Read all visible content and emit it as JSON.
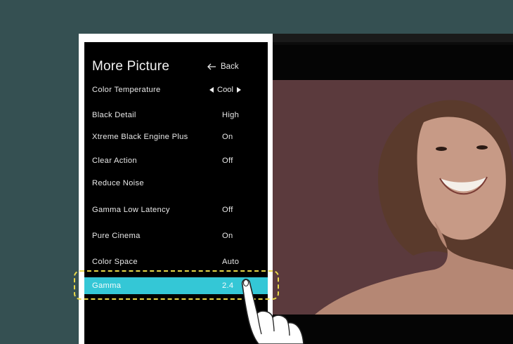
{
  "menu": {
    "title": "More Picture",
    "back_label": "Back",
    "color_temperature": {
      "label": "Color Temperature",
      "value": "Cool"
    },
    "items": [
      {
        "label": "Black Detail",
        "value": "High"
      },
      {
        "label": "Xtreme Black Engine Plus",
        "value": "On"
      },
      {
        "label": "Clear Action",
        "value": "Off"
      },
      {
        "label": "Reduce Noise",
        "value": ""
      },
      {
        "label": "Gamma Low Latency",
        "value": "Off"
      },
      {
        "label": "Pure Cinema",
        "value": "On"
      },
      {
        "label": "Color Space",
        "value": "Auto"
      },
      {
        "label": "Gamma",
        "value": "2.4"
      }
    ]
  },
  "colors": {
    "background": "#355052",
    "menu_bg": "#000000",
    "selected_row": "#34c7d6",
    "highlight": "#e8d84a",
    "photo_bg": "#5b3a3d"
  }
}
